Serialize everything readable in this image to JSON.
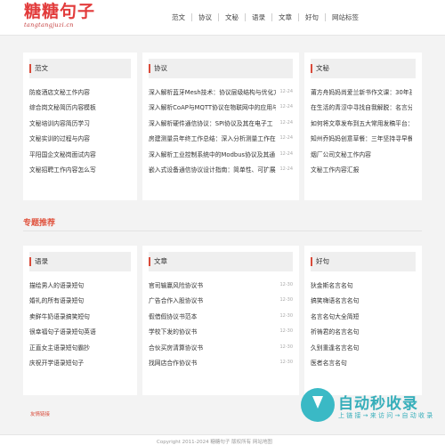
{
  "logo": {
    "main": "糖糖句子",
    "sub": "tangtangjuzi.cn"
  },
  "nav": [
    "范文",
    "协议",
    "文秘",
    "语录",
    "文章",
    "好句",
    "网站标签"
  ],
  "top_cards": [
    {
      "title": "范文",
      "items": [
        {
          "text": "防疫酒店文秘工作内容",
          "date": ""
        },
        {
          "text": "综合岗文秘简历内容模板",
          "date": ""
        },
        {
          "text": "文秘培训内容简历学习",
          "date": ""
        },
        {
          "text": "文秘实训的过程与内容",
          "date": ""
        },
        {
          "text": "平阳国企文秘岗面试内容",
          "date": ""
        },
        {
          "text": "文秘招聘工作内容怎么写",
          "date": ""
        }
      ]
    },
    {
      "title": "协议",
      "items": [
        {
          "text": "深入解析蓝牙Mesh技术：协议层级结构与优化方",
          "date": "12-24"
        },
        {
          "text": "深入解析CoAP与MQTT协议在物联网中的应用与",
          "date": "12-24"
        },
        {
          "text": "深入解析硬件通信协议：SPI协议及其在电子工",
          "date": "12-24"
        },
        {
          "text": "房建测量员年终工作总结：深入分析测量工作在",
          "date": "12-24"
        },
        {
          "text": "深入解析工业控制系统中的Modbus协议及其通",
          "date": "12-24"
        },
        {
          "text": "嵌入式设备通信协议设计指南：简单性、可扩展",
          "date": "12-24"
        }
      ]
    },
    {
      "title": "文秘",
      "items": [
        {
          "text": "莆方舟妈妈尚爱兰新书作文课：30年孩子作文",
          "date": ""
        },
        {
          "text": "在生活的青涩中寻找自我解脱：名言分享",
          "date": ""
        },
        {
          "text": "如何将文章发布到五大常用发稿平台：公",
          "date": ""
        },
        {
          "text": "知州乔妈妈创意草餐：三年坚持寻早餐饭",
          "date": ""
        },
        {
          "text": "烟厂公司文秘工作内容",
          "date": ""
        },
        {
          "text": "文秘工作内容汇报",
          "date": ""
        }
      ]
    }
  ],
  "section_title": "专题推荐",
  "bottom_cards": [
    {
      "title": "语录",
      "items": [
        {
          "text": "描绘男人的语录短句",
          "date": ""
        },
        {
          "text": "婚礼的所有语录短句",
          "date": ""
        },
        {
          "text": "卖鲜牛奶语录搞笑短句",
          "date": ""
        },
        {
          "text": "很幸福句子语录短句英语",
          "date": ""
        },
        {
          "text": "正直女主语录短句霸抄",
          "date": ""
        },
        {
          "text": "庆祝开学语录短句子",
          "date": ""
        }
      ]
    },
    {
      "title": "文章",
      "items": [
        {
          "text": "官司输赢风险协议书",
          "date": "12-30"
        },
        {
          "text": "广告合作入股协议书",
          "date": "12-30"
        },
        {
          "text": "假借假协议书范本",
          "date": "12-30"
        },
        {
          "text": "学校下发的协议书",
          "date": "12-30"
        },
        {
          "text": "合伙买房清算协议书",
          "date": "12-30"
        },
        {
          "text": "找网店合作协议书",
          "date": "12-30"
        }
      ]
    },
    {
      "title": "好句",
      "items": [
        {
          "text": "狄金斯名言名句",
          "date": ""
        },
        {
          "text": "搞笑嗨语名言名句",
          "date": ""
        },
        {
          "text": "名言名句大全简短",
          "date": ""
        },
        {
          "text": "祈祷君的名言名句",
          "date": ""
        },
        {
          "text": "久别重逢名言名句",
          "date": ""
        },
        {
          "text": "医者名言名句",
          "date": ""
        }
      ]
    }
  ],
  "links_label": "友情链接",
  "footer": "Copyright 2011-2024 糖糖句子 版权所有 网站地图",
  "watermark": {
    "main": "自动秒收录",
    "sub": "上 链 接 → 来 访 问 → 自 动 收 录"
  },
  "colors": {
    "accent": "#e0533e",
    "bar": "#d94b3a",
    "watermark": "#26a9b6"
  }
}
